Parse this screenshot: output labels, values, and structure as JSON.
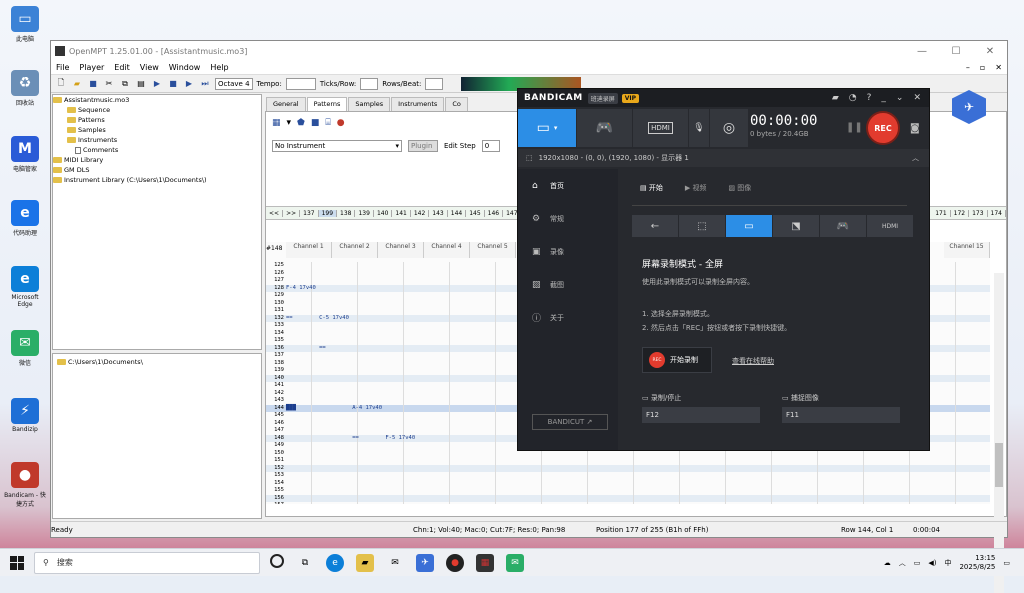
{
  "desktop": {
    "icons": [
      {
        "label": "此电脑",
        "color": "#3b82d6",
        "glyph": "▭"
      },
      {
        "label": "回收站",
        "color": "#6b8fb7",
        "glyph": "♻"
      },
      {
        "label": "电脑管家",
        "color": "#2a5bd7",
        "glyph": "M"
      },
      {
        "label": "代码助理",
        "color": "#1a73e8",
        "glyph": "e"
      },
      {
        "label": "Microsoft Edge",
        "color": "#0c7fd8",
        "glyph": "e"
      },
      {
        "label": "微信",
        "color": "#2aae67",
        "glyph": "✉"
      },
      {
        "label": "Bandizip",
        "color": "#1e6fd6",
        "glyph": "⚡"
      },
      {
        "label": "Bandicam - 快捷方式",
        "color": "#c0392b",
        "glyph": "●"
      }
    ]
  },
  "openmpt": {
    "title": "OpenMPT 1.25.01.00 - [Assistantmusic.mo3]",
    "menu": [
      "File",
      "Player",
      "Edit",
      "View",
      "Window",
      "Help"
    ],
    "toolbar": {
      "octave_label": "Octave 4",
      "tempo_label": "Tempo:",
      "ticks_label": "Ticks/Row:",
      "rows_label": "Rows/Beat:"
    },
    "tree": {
      "root": "Assistantmusic.mo3",
      "children": [
        "Sequence",
        "Patterns",
        "Samples",
        "Instruments",
        "Comments"
      ],
      "others": [
        "MIDI Library",
        "GM DLS",
        "Instrument Library (C:\\Users\\1\\Documents\\)"
      ]
    },
    "path": "C:\\Users\\1\\Documents\\",
    "tabs": [
      "General",
      "Patterns",
      "Samples",
      "Instruments",
      "Co"
    ],
    "instrument": {
      "selected": "No Instrument",
      "plugin_label": "Plugin",
      "edit_step_label": "Edit Step",
      "edit_step_value": "0"
    },
    "orders": [
      "<<",
      ">>",
      "137",
      "199",
      "138",
      "139",
      "140",
      "141",
      "142",
      "143",
      "144",
      "145",
      "146",
      "147",
      "199"
    ],
    "orders_right": [
      "171",
      "172",
      "173",
      "174"
    ],
    "pattern_id": "#148",
    "channels": [
      "Channel 1",
      "Channel 2",
      "Channel 3",
      "Channel 4",
      "Channel 5"
    ],
    "channel_right": "Channel 15",
    "rows": [
      {
        "n": "125",
        "c": ""
      },
      {
        "n": "126",
        "c": ""
      },
      {
        "n": "127",
        "c": ""
      },
      {
        "n": "128",
        "c": "F-4 17v40"
      },
      {
        "n": "129",
        "c": ""
      },
      {
        "n": "130",
        "c": ""
      },
      {
        "n": "131",
        "c": ""
      },
      {
        "n": "132",
        "c": "==        C-5 17v40"
      },
      {
        "n": "133",
        "c": ""
      },
      {
        "n": "134",
        "c": ""
      },
      {
        "n": "135",
        "c": ""
      },
      {
        "n": "136",
        "c": "          =="
      },
      {
        "n": "137",
        "c": ""
      },
      {
        "n": "138",
        "c": ""
      },
      {
        "n": "139",
        "c": ""
      },
      {
        "n": "140",
        "c": ""
      },
      {
        "n": "141",
        "c": ""
      },
      {
        "n": "142",
        "c": ""
      },
      {
        "n": "143",
        "c": ""
      },
      {
        "n": "144",
        "c": "███                 A-4 17v40"
      },
      {
        "n": "145",
        "c": ""
      },
      {
        "n": "146",
        "c": ""
      },
      {
        "n": "147",
        "c": ""
      },
      {
        "n": "148",
        "c": "                    ==        F-5 17v40"
      },
      {
        "n": "149",
        "c": ""
      },
      {
        "n": "150",
        "c": ""
      },
      {
        "n": "151",
        "c": ""
      },
      {
        "n": "152",
        "c": ""
      },
      {
        "n": "153",
        "c": ""
      },
      {
        "n": "154",
        "c": ""
      },
      {
        "n": "155",
        "c": ""
      },
      {
        "n": "156",
        "c": ""
      },
      {
        "n": "157",
        "c": ""
      },
      {
        "n": "158",
        "c": ""
      },
      {
        "n": "159",
        "c": ""
      },
      {
        "n": "160",
        "c": "A#4 17v40"
      },
      {
        "n": "161",
        "c": ""
      },
      {
        "n": "162",
        "c": ""
      },
      {
        "n": "163",
        "c": ""
      }
    ],
    "status": {
      "ready": "Ready",
      "channel_info": "Chn:1; Vol:40; Mac:0; Cut:7F; Res:0; Pan:98",
      "position": "Position 177 of 255 (B1h of FFh)",
      "row": "Row 144, Col 1",
      "time": "0:00:04"
    }
  },
  "bandicam": {
    "logo": "BANDICAM",
    "badge": "班迪录屏",
    "vip": "VIP",
    "timer": "00:00:00",
    "size": "0 bytes / 20.4GB",
    "rec": "REC",
    "resolution": "1920x1080 - (0, 0), (1920, 1080) - 显示器 1",
    "nav": [
      "首页",
      "常规",
      "录像",
      "截图",
      "关于"
    ],
    "bandicut": "BANDICUT ↗",
    "subtabs": [
      "开始",
      "视频",
      "图像"
    ],
    "mode_title": "屏幕录制模式 - 全屏",
    "mode_desc": "使用此录制模式可以录制全屏内容。",
    "step1": "1. 选择全屏录制模式。",
    "step2": "2. 然后点击「REC」按钮或者按下录制快捷键。",
    "start_label": "开始录制",
    "start_dot": "REC",
    "help_label": "查看在线帮助",
    "hotkey_rec_label": "录制/停止",
    "hotkey_rec": "F12",
    "hotkey_cap_label": "捕捉图像",
    "hotkey_cap": "F11"
  },
  "taskbar": {
    "search_placeholder": "搜索",
    "time": "13:15",
    "date": "2025/8/25",
    "ime": "中"
  }
}
